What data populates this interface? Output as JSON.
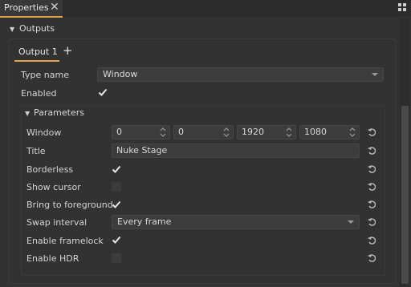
{
  "header": {
    "tab_label": "Properties"
  },
  "outputs": {
    "section_label": "Outputs",
    "tab_label": "Output 1",
    "type_name_label": "Type name",
    "type_name_value": "Window",
    "enabled_label": "Enabled",
    "enabled_checked": true
  },
  "parameters": {
    "section_label": "Parameters",
    "window_label": "Window",
    "window_values": [
      "0",
      "0",
      "1920",
      "1080"
    ],
    "title_label": "Title",
    "title_value": "Nuke Stage",
    "borderless_label": "Borderless",
    "show_cursor_label": "Show cursor",
    "bring_to_foreground_label": "Bring to foreground",
    "swap_interval_label": "Swap interval",
    "swap_interval_value": "Every frame",
    "enable_framelock_label": "Enable framelock",
    "enable_hdr_label": "Enable HDR"
  },
  "colors": {
    "accent": "#e3a347",
    "background": "#323232",
    "field": "#3c3c3c"
  }
}
